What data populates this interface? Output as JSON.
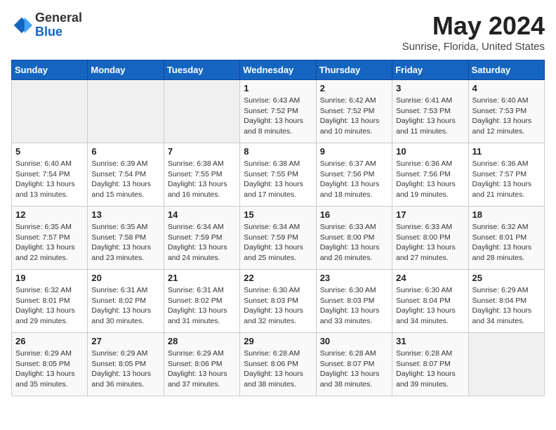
{
  "logo": {
    "general": "General",
    "blue": "Blue"
  },
  "title": "May 2024",
  "subtitle": "Sunrise, Florida, United States",
  "weekdays": [
    "Sunday",
    "Monday",
    "Tuesday",
    "Wednesday",
    "Thursday",
    "Friday",
    "Saturday"
  ],
  "weeks": [
    [
      {
        "day": "",
        "info": ""
      },
      {
        "day": "",
        "info": ""
      },
      {
        "day": "",
        "info": ""
      },
      {
        "day": "1",
        "info": "Sunrise: 6:43 AM\nSunset: 7:52 PM\nDaylight: 13 hours\nand 8 minutes."
      },
      {
        "day": "2",
        "info": "Sunrise: 6:42 AM\nSunset: 7:52 PM\nDaylight: 13 hours\nand 10 minutes."
      },
      {
        "day": "3",
        "info": "Sunrise: 6:41 AM\nSunset: 7:53 PM\nDaylight: 13 hours\nand 11 minutes."
      },
      {
        "day": "4",
        "info": "Sunrise: 6:40 AM\nSunset: 7:53 PM\nDaylight: 13 hours\nand 12 minutes."
      }
    ],
    [
      {
        "day": "5",
        "info": "Sunrise: 6:40 AM\nSunset: 7:54 PM\nDaylight: 13 hours\nand 13 minutes."
      },
      {
        "day": "6",
        "info": "Sunrise: 6:39 AM\nSunset: 7:54 PM\nDaylight: 13 hours\nand 15 minutes."
      },
      {
        "day": "7",
        "info": "Sunrise: 6:38 AM\nSunset: 7:55 PM\nDaylight: 13 hours\nand 16 minutes."
      },
      {
        "day": "8",
        "info": "Sunrise: 6:38 AM\nSunset: 7:55 PM\nDaylight: 13 hours\nand 17 minutes."
      },
      {
        "day": "9",
        "info": "Sunrise: 6:37 AM\nSunset: 7:56 PM\nDaylight: 13 hours\nand 18 minutes."
      },
      {
        "day": "10",
        "info": "Sunrise: 6:36 AM\nSunset: 7:56 PM\nDaylight: 13 hours\nand 19 minutes."
      },
      {
        "day": "11",
        "info": "Sunrise: 6:36 AM\nSunset: 7:57 PM\nDaylight: 13 hours\nand 21 minutes."
      }
    ],
    [
      {
        "day": "12",
        "info": "Sunrise: 6:35 AM\nSunset: 7:57 PM\nDaylight: 13 hours\nand 22 minutes."
      },
      {
        "day": "13",
        "info": "Sunrise: 6:35 AM\nSunset: 7:58 PM\nDaylight: 13 hours\nand 23 minutes."
      },
      {
        "day": "14",
        "info": "Sunrise: 6:34 AM\nSunset: 7:59 PM\nDaylight: 13 hours\nand 24 minutes."
      },
      {
        "day": "15",
        "info": "Sunrise: 6:34 AM\nSunset: 7:59 PM\nDaylight: 13 hours\nand 25 minutes."
      },
      {
        "day": "16",
        "info": "Sunrise: 6:33 AM\nSunset: 8:00 PM\nDaylight: 13 hours\nand 26 minutes."
      },
      {
        "day": "17",
        "info": "Sunrise: 6:33 AM\nSunset: 8:00 PM\nDaylight: 13 hours\nand 27 minutes."
      },
      {
        "day": "18",
        "info": "Sunrise: 6:32 AM\nSunset: 8:01 PM\nDaylight: 13 hours\nand 28 minutes."
      }
    ],
    [
      {
        "day": "19",
        "info": "Sunrise: 6:32 AM\nSunset: 8:01 PM\nDaylight: 13 hours\nand 29 minutes."
      },
      {
        "day": "20",
        "info": "Sunrise: 6:31 AM\nSunset: 8:02 PM\nDaylight: 13 hours\nand 30 minutes."
      },
      {
        "day": "21",
        "info": "Sunrise: 6:31 AM\nSunset: 8:02 PM\nDaylight: 13 hours\nand 31 minutes."
      },
      {
        "day": "22",
        "info": "Sunrise: 6:30 AM\nSunset: 8:03 PM\nDaylight: 13 hours\nand 32 minutes."
      },
      {
        "day": "23",
        "info": "Sunrise: 6:30 AM\nSunset: 8:03 PM\nDaylight: 13 hours\nand 33 minutes."
      },
      {
        "day": "24",
        "info": "Sunrise: 6:30 AM\nSunset: 8:04 PM\nDaylight: 13 hours\nand 34 minutes."
      },
      {
        "day": "25",
        "info": "Sunrise: 6:29 AM\nSunset: 8:04 PM\nDaylight: 13 hours\nand 34 minutes."
      }
    ],
    [
      {
        "day": "26",
        "info": "Sunrise: 6:29 AM\nSunset: 8:05 PM\nDaylight: 13 hours\nand 35 minutes."
      },
      {
        "day": "27",
        "info": "Sunrise: 6:29 AM\nSunset: 8:05 PM\nDaylight: 13 hours\nand 36 minutes."
      },
      {
        "day": "28",
        "info": "Sunrise: 6:29 AM\nSunset: 8:06 PM\nDaylight: 13 hours\nand 37 minutes."
      },
      {
        "day": "29",
        "info": "Sunrise: 6:28 AM\nSunset: 8:06 PM\nDaylight: 13 hours\nand 38 minutes."
      },
      {
        "day": "30",
        "info": "Sunrise: 6:28 AM\nSunset: 8:07 PM\nDaylight: 13 hours\nand 38 minutes."
      },
      {
        "day": "31",
        "info": "Sunrise: 6:28 AM\nSunset: 8:07 PM\nDaylight: 13 hours\nand 39 minutes."
      },
      {
        "day": "",
        "info": ""
      }
    ]
  ]
}
